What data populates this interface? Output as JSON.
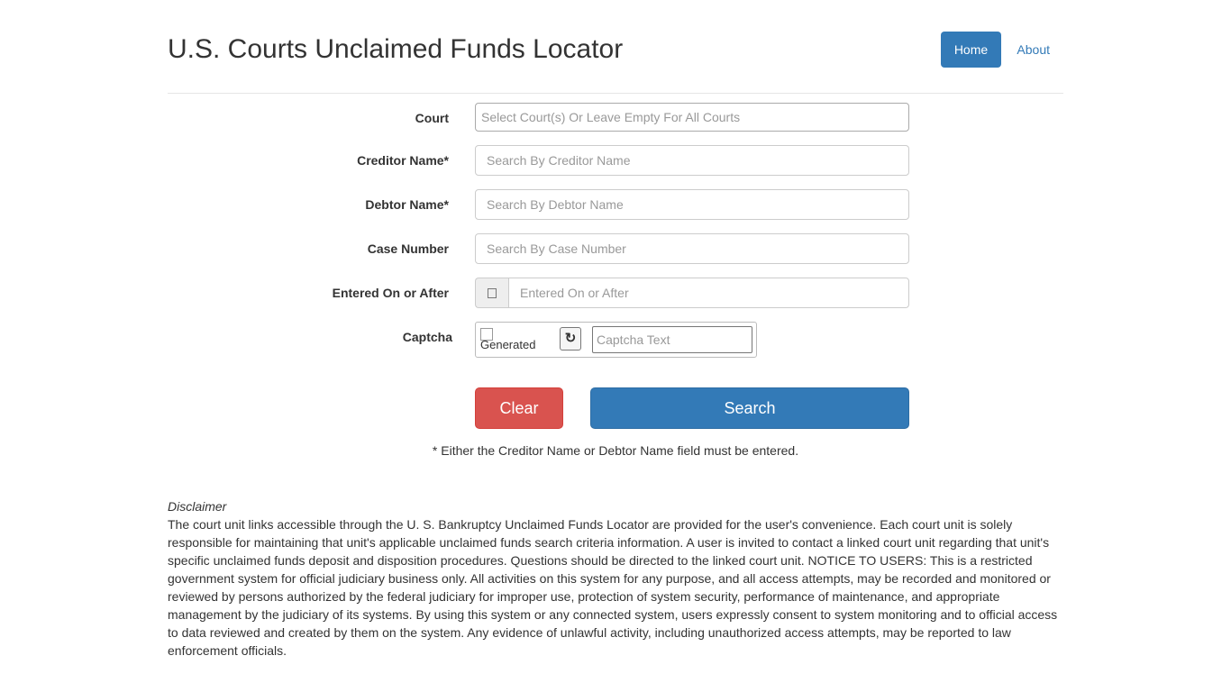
{
  "header": {
    "title": "U.S. Courts Unclaimed Funds Locator",
    "nav": {
      "home": "Home",
      "about": "About"
    }
  },
  "form": {
    "court": {
      "label": "Court",
      "placeholder": "Select Court(s) Or Leave Empty For All Courts"
    },
    "creditor": {
      "label": "Creditor Name*",
      "placeholder": "Search By Creditor Name"
    },
    "debtor": {
      "label": "Debtor Name*",
      "placeholder": "Search By Debtor Name"
    },
    "case_number": {
      "label": "Case Number",
      "placeholder": "Search By Case Number"
    },
    "entered_on": {
      "label": "Entered On or After",
      "addon_icon": "calendar-icon",
      "placeholder": "Entered On or After"
    },
    "captcha": {
      "label": "Captcha",
      "image_alt": "Generated",
      "refresh_icon": "↻",
      "placeholder": "Captcha Text"
    },
    "buttons": {
      "clear": "Clear",
      "search": "Search"
    },
    "required_note": "* Either the Creditor Name or Debtor Name field must be entered."
  },
  "disclaimer": {
    "title": "Disclaimer",
    "body": "The court unit links accessible through the U. S. Bankruptcy Unclaimed Funds Locator are provided for the user's convenience. Each court unit is solely responsible for maintaining that unit's applicable unclaimed funds search criteria information. A user is invited to contact a linked court unit regarding that unit's specific unclaimed funds deposit and disposition procedures. Questions should be directed to the linked court unit. NOTICE TO USERS: This is a restricted government system for official judiciary business only. All activities on this system for any purpose, and all access attempts, may be recorded and monitored or reviewed by persons authorized by the federal judiciary for improper use, protection of system security, performance of maintenance, and appropriate management by the judiciary of its systems. By using this system or any connected system, users expressly consent to system monitoring and to official access to data reviewed and created by them on the system. Any evidence of unlawful activity, including unauthorized access attempts, may be reported to law enforcement officials."
  },
  "colors": {
    "primary": "#337ab7",
    "danger": "#d9534f",
    "text": "#333333",
    "placeholder": "#999999"
  }
}
